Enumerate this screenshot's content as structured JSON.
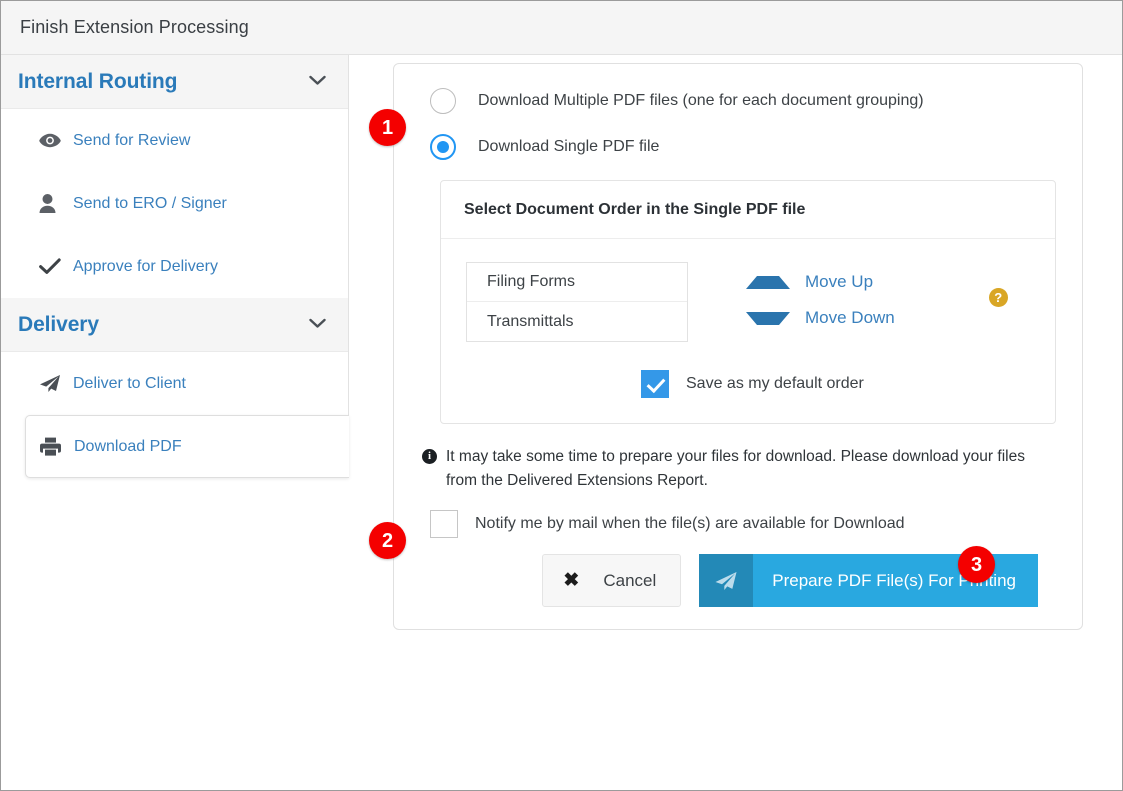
{
  "window": {
    "title": "Finish Extension Processing"
  },
  "sidebar": {
    "sections": [
      {
        "title": "Internal Routing",
        "chevron": "chevron-down-icon",
        "items": [
          {
            "label": "Send for Review",
            "icon": "eye-icon"
          },
          {
            "label": "Send to ERO / Signer",
            "icon": "user-icon"
          },
          {
            "label": "Approve for Delivery",
            "icon": "check-icon"
          }
        ]
      },
      {
        "title": "Delivery",
        "chevron": "chevron-down-icon",
        "items": [
          {
            "label": "Deliver to Client",
            "icon": "paper-plane-icon"
          },
          {
            "label": "Download PDF",
            "icon": "printer-icon"
          }
        ]
      }
    ]
  },
  "main": {
    "download_options": [
      {
        "label": "Download Multiple PDF files (one for each document grouping)",
        "selected": false
      },
      {
        "label": "Download Single PDF file",
        "selected": true
      }
    ],
    "order_panel": {
      "heading": "Select Document Order in the Single PDF file",
      "documents": [
        "Filing Forms",
        "Transmittals"
      ],
      "move_up_label": "Move Up",
      "move_down_label": "Move Down",
      "help_glyph": "?",
      "default_order": {
        "label": "Save as my default order",
        "checked": true
      }
    },
    "note": {
      "icon_glyph": "i",
      "text": "It may take some time to prepare your files for download. Please download your files from the Delivered Extensions Report."
    },
    "notify": {
      "label": "Notify me by mail when the file(s) are available for Download",
      "checked": false
    },
    "buttons": {
      "cancel": "Cancel",
      "prepare": "Prepare PDF File(s) For Printing"
    }
  },
  "badges": [
    {
      "number": "1"
    },
    {
      "number": "2"
    },
    {
      "number": "3"
    }
  ],
  "colors": {
    "accent_blue": "#3a80bd",
    "primary_button": "#29a8e0",
    "badge_red": "#f40000",
    "help_amber": "#d9a625",
    "checkbox_blue": "#3498e8"
  }
}
